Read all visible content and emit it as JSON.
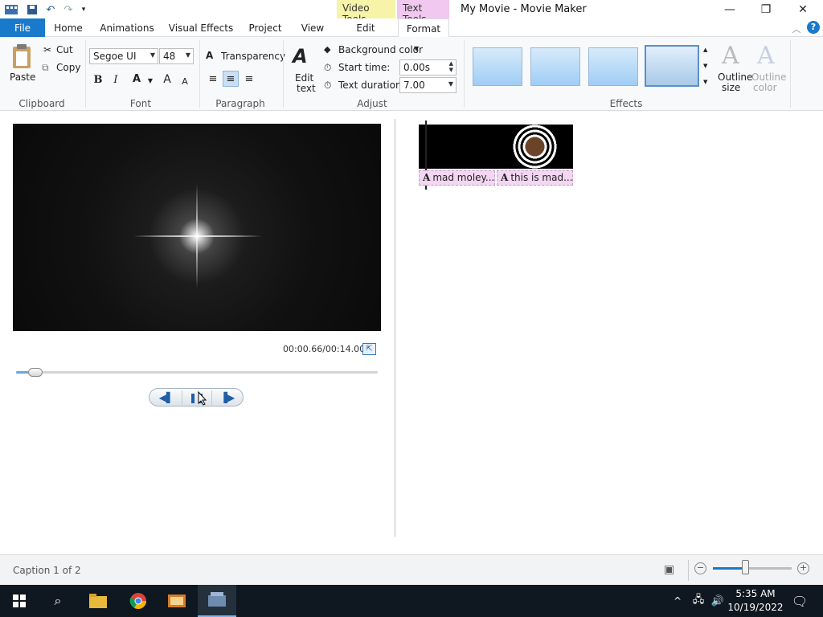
{
  "titlebar": {
    "context_video": "Video Tools",
    "context_text": "Text Tools",
    "title": "My Movie - Movie Maker",
    "minimize_glyph": "—",
    "restore_glyph": "❐",
    "close_glyph": "✕"
  },
  "tabs": {
    "file": "File",
    "home": "Home",
    "animations": "Animations",
    "visual_effects": "Visual Effects",
    "project": "Project",
    "view": "View",
    "edit": "Edit",
    "format": "Format"
  },
  "ribbon": {
    "clipboard": {
      "label": "Clipboard",
      "paste": "Paste",
      "cut": "Cut",
      "copy": "Copy"
    },
    "font": {
      "label": "Font",
      "family": "Segoe UI",
      "size": "48",
      "bold": "B",
      "italic": "I",
      "color": "A",
      "grow": "A",
      "shrink": "A"
    },
    "transparency": "Transparency",
    "paragraph": {
      "label": "Paragraph"
    },
    "adjust": {
      "label": "Adjust",
      "edit_text_line1": "Edit",
      "edit_text_line2": "text",
      "background_color": "Background color",
      "start_time_label": "Start time:",
      "start_time_value": "0.00s",
      "text_duration_label": "Text duration:",
      "text_duration_value": "7.00"
    },
    "effects": {
      "label": "Effects",
      "outline_size_1": "Outline",
      "outline_size_2": "size",
      "outline_color_1": "Outline",
      "outline_color_2": "color"
    }
  },
  "preview": {
    "time": "00:00.66/00:14.00",
    "seek_progress": 0.047
  },
  "storyboard": {
    "captions": [
      {
        "text": "mad moley..."
      },
      {
        "text": "this is mad..."
      }
    ]
  },
  "status": {
    "text": "Caption 1 of 2"
  },
  "taskbar": {
    "time": "5:35 AM",
    "date": "10/19/2022"
  }
}
